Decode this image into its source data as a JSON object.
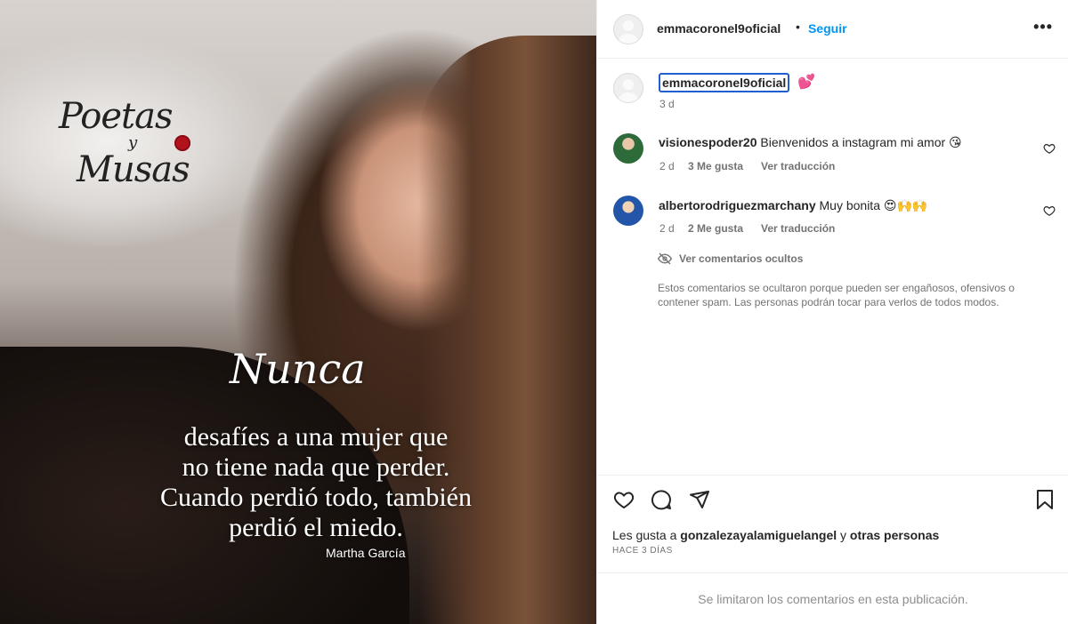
{
  "post": {
    "image": {
      "logo": {
        "line1": "Poetas",
        "line2": "y",
        "line3": "Musas"
      },
      "quote_title": "Nunca",
      "quote_lines": [
        "desafíes a una mujer que",
        "no tiene nada que perder.",
        "Cuando perdió todo, también",
        "perdió el miedo."
      ],
      "author": "Martha García"
    }
  },
  "header": {
    "username": "emmacoronel9oficial",
    "separator": "•",
    "follow_label": "Seguir",
    "more_icon": "more-horizontal-icon"
  },
  "caption": {
    "username": "emmacoronel9oficial",
    "emoji": "💕",
    "time": "3 d"
  },
  "comments": [
    {
      "username": "visionespoder20",
      "text": "Bienvenidos a instagram mi amor 😘",
      "time": "2 d",
      "likes": "3 Me gusta",
      "translate": "Ver traducción"
    },
    {
      "username": "albertorodriguezmarchany",
      "text": "Muy bonita 😍🙌🙌",
      "time": "2 d",
      "likes": "2 Me gusta",
      "translate": "Ver traducción"
    }
  ],
  "hidden": {
    "link": "Ver comentarios ocultos",
    "note": "Estos comentarios se ocultaron porque pueden ser engañosos, ofensivos o contener spam. Las personas podrán tocar para verlos de todos modos."
  },
  "likes": {
    "prefix": "Les gusta a",
    "user": "gonzalezayalamiguelangel",
    "joiner": "y",
    "others": "otras personas"
  },
  "date_label": "HACE 3 DÍAS",
  "limited_notice": "Se limitaron los comentarios en esta publicación.",
  "colors": {
    "accent": "#0095f6",
    "muted": "#737373",
    "text": "#262626"
  }
}
